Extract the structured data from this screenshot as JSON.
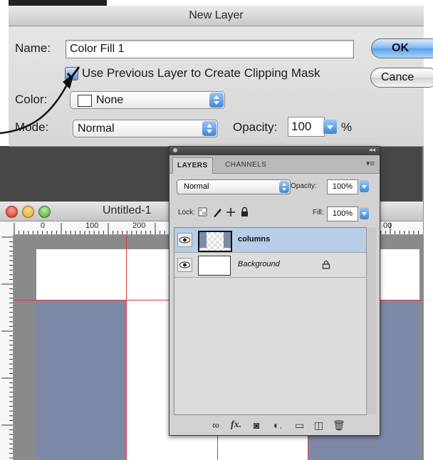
{
  "dialog": {
    "title": "New Layer",
    "name_label": "Name:",
    "name_value": "Color Fill 1",
    "clip_label": "Use Previous Layer to Create Clipping Mask",
    "clip_checked": true,
    "color_label": "Color:",
    "color_value": "None",
    "mode_label": "Mode:",
    "mode_value": "Normal",
    "opacity_label": "Opacity:",
    "opacity_value": "100",
    "opacity_unit": "%",
    "ok_label": "OK",
    "cancel_label": "Cance"
  },
  "document": {
    "title": "Untitled-1",
    "ruler_marks": [
      "0",
      "100",
      "200",
      "00"
    ],
    "column_color": "#7c8aa8",
    "guide_color": "#e9383c"
  },
  "layers_panel": {
    "tabs": [
      "LAYERS",
      "CHANNELS"
    ],
    "blend_mode": "Normal",
    "opacity_label": "Opacity:",
    "opacity_value": "100%",
    "lock_label": "Lock:",
    "fill_label": "Fill:",
    "fill_value": "100%",
    "layers": [
      {
        "name": "columns",
        "selected": true,
        "visible": true
      },
      {
        "name": "Background",
        "selected": false,
        "visible": true,
        "locked": true
      }
    ],
    "footer_icons": [
      "link-icon",
      "fx-icon",
      "mask-icon",
      "adjustment-icon",
      "folder-icon",
      "new-layer-icon",
      "trash-icon"
    ]
  }
}
